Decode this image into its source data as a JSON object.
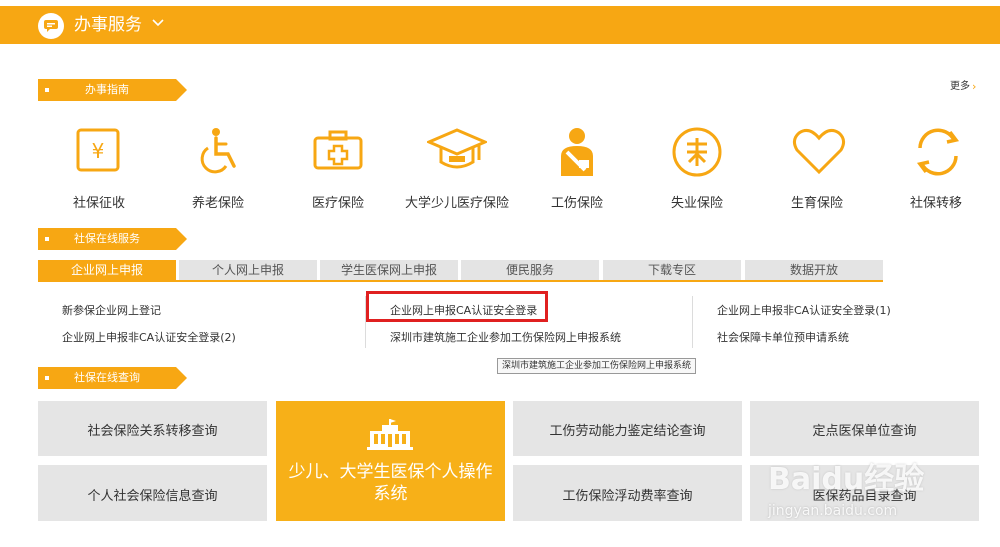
{
  "header": {
    "title": "办事服务",
    "title_icon": "chat-icon",
    "chevron_icon": "chevron-down-icon"
  },
  "guide": {
    "section_label": "办事指南",
    "more_label": "更多",
    "more_icon": "chevron-right-icon",
    "items": [
      {
        "label": "社保征收",
        "icon": "yuan-icon"
      },
      {
        "label": "养老保险",
        "icon": "wheelchair-icon"
      },
      {
        "label": "医疗保险",
        "icon": "medical-kit-icon"
      },
      {
        "label": "大学少儿医疗保险",
        "icon": "graduation-cap-icon"
      },
      {
        "label": "工伤保险",
        "icon": "injured-person-icon"
      },
      {
        "label": "失业保险",
        "icon": "unemployment-icon"
      },
      {
        "label": "生育保险",
        "icon": "heart-icon"
      },
      {
        "label": "社保转移",
        "icon": "transfer-arrows-icon"
      }
    ]
  },
  "online_service": {
    "section_label": "社保在线服务",
    "tabs": [
      "企业网上申报",
      "个人网上申报",
      "学生医保网上申报",
      "便民服务",
      "下载专区",
      "数据开放"
    ],
    "active_tab": "企业网上申报",
    "links": [
      "新参保企业网上登记",
      "企业网上申报CA认证安全登录",
      "企业网上申报非CA认证安全登录(1)",
      "企业网上申报非CA认证安全登录(2)",
      "深圳市建筑施工企业参加工伤保险网上申报系统",
      "社会保障卡单位预申请系统"
    ],
    "tooltip": "深圳市建筑施工企业参加工伤保险网上申报系统",
    "highlight_color": "#e02020"
  },
  "online_query": {
    "section_label": "社保在线查询",
    "tiles": [
      "社会保险关系转移查询",
      "工伤劳动能力鉴定结论查询",
      "定点医保单位查询",
      "个人社会保险信息查询",
      "工伤保险浮动费率查询",
      "医保药品目录查询"
    ],
    "featured": {
      "line1": "少儿、大学生医保个人操作",
      "line2": "系统",
      "icon": "building-icon"
    }
  },
  "watermark": {
    "line1": "Baidu经验",
    "line2": "jingyan.baidu.com"
  },
  "colors": {
    "accent": "#f7a713",
    "tile_bg": "#e5e5e5",
    "tab_bg": "#e4e4e4"
  }
}
